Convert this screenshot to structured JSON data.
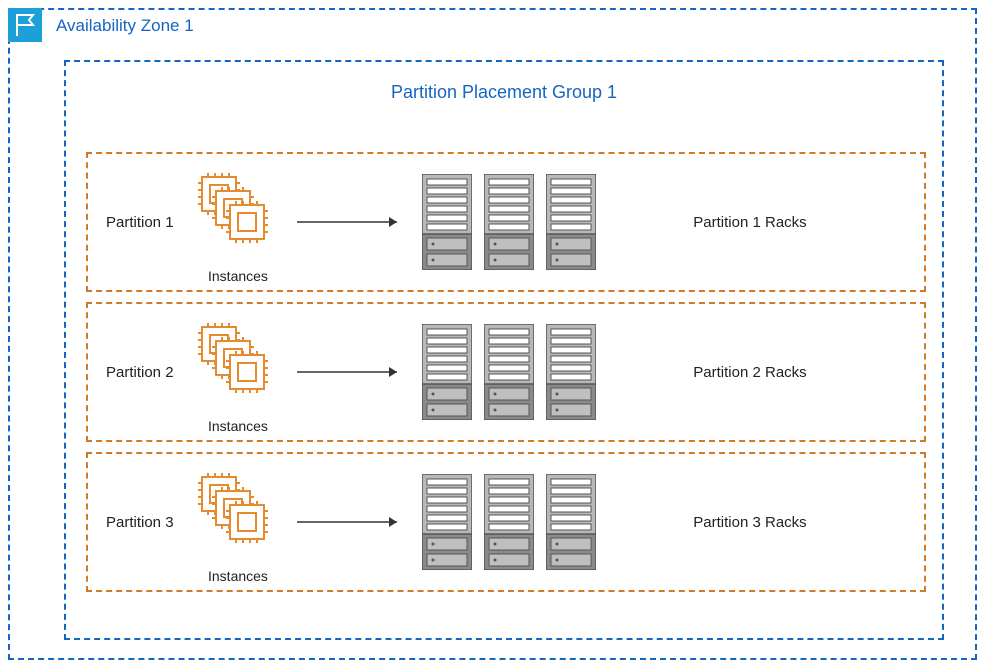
{
  "availability_zone": {
    "title": "Availability Zone 1"
  },
  "placement_group": {
    "title": "Partition Placement Group 1"
  },
  "partitions": [
    {
      "label": "Partition 1",
      "instances_caption": "Instances",
      "racks_label": "Partition 1 Racks"
    },
    {
      "label": "Partition 2",
      "instances_caption": "Instances",
      "racks_label": "Partition 2 Racks"
    },
    {
      "label": "Partition 3",
      "instances_caption": "Instances",
      "racks_label": "Partition 3 Racks"
    }
  ]
}
